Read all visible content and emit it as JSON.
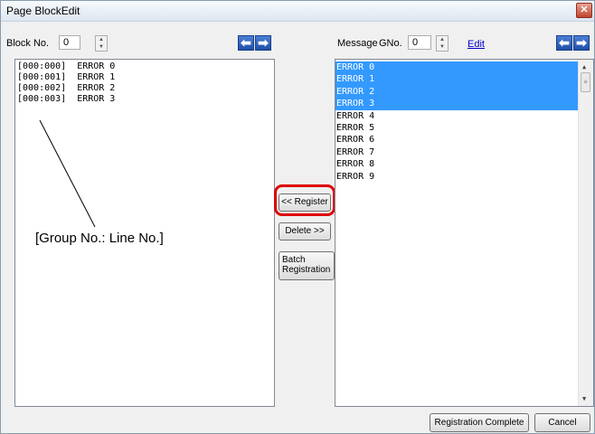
{
  "window": {
    "title": "Page BlockEdit",
    "close_symbol": "✕"
  },
  "left": {
    "block_label": "Block No.",
    "block_value": "0",
    "list": [
      {
        "id": "[000:000]",
        "text": "ERROR 0"
      },
      {
        "id": "[000:001]",
        "text": "ERROR 1"
      },
      {
        "id": "[000:002]",
        "text": "ERROR 2"
      },
      {
        "id": "[000:003]",
        "text": "ERROR 3"
      }
    ]
  },
  "right": {
    "message_label": "Message",
    "gno_label": "GNo.",
    "gno_value": "0",
    "edit_link": "Edit",
    "list": [
      {
        "text": "ERROR 0",
        "selected": true
      },
      {
        "text": "ERROR 1",
        "selected": true
      },
      {
        "text": "ERROR 2",
        "selected": true
      },
      {
        "text": "ERROR 3",
        "selected": true
      },
      {
        "text": "ERROR 4",
        "selected": false
      },
      {
        "text": "ERROR 5",
        "selected": false
      },
      {
        "text": "ERROR 6",
        "selected": false
      },
      {
        "text": "ERROR 7",
        "selected": false
      },
      {
        "text": "ERROR 8",
        "selected": false
      },
      {
        "text": "ERROR 9",
        "selected": false
      }
    ]
  },
  "buttons": {
    "register": "<< Register",
    "delete": "Delete >>",
    "batch_line1": "Batch",
    "batch_line2": "Registration",
    "complete": "Registration Complete",
    "cancel": "Cancel"
  },
  "annotation": "[Group No.: Line No.]",
  "icons": {
    "arrow_left": "⬅",
    "arrow_right": "➡",
    "spin_up": "▲",
    "spin_down": "▼",
    "scroll_up": "▲",
    "scroll_down": "▼",
    "scroll_grip": "≡"
  },
  "colors": {
    "selection": "#3399ff",
    "highlight_ring": "#e00000"
  }
}
